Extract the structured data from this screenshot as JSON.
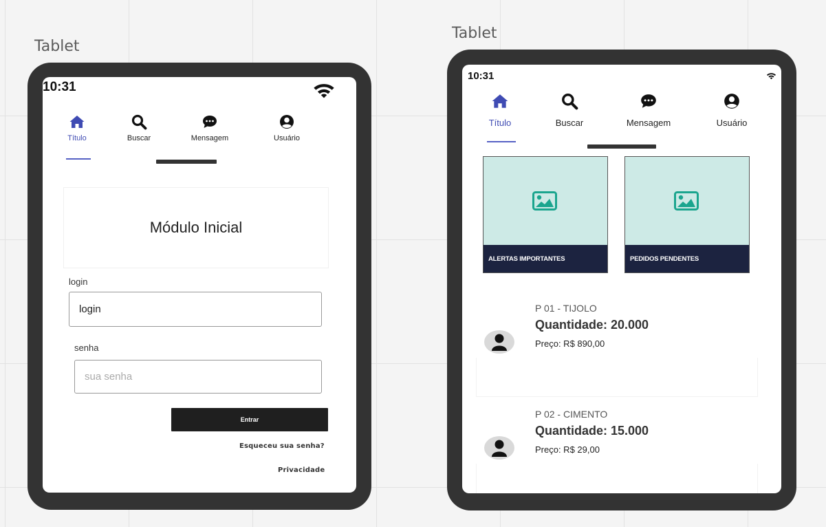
{
  "frames": [
    {
      "label": "Tablet",
      "status_bar": {
        "time": "10:31"
      },
      "nav": [
        {
          "label": "Título",
          "icon": "home-icon",
          "active": true
        },
        {
          "label": "Buscar",
          "icon": "search-icon",
          "active": false
        },
        {
          "label": "Mensagem",
          "icon": "chat-icon",
          "active": false
        },
        {
          "label": "Usuário",
          "icon": "user-circle-icon",
          "active": false
        }
      ],
      "title_card": "Módulo Inicial",
      "login": {
        "label": "login",
        "value": "login"
      },
      "password": {
        "label": "senha",
        "placeholder": "sua senha"
      },
      "enter_button": "Entrar",
      "forgot_link": "Esqueceu sua senha?",
      "privacy_link": "Privacidade"
    },
    {
      "label": "Tablet",
      "status_bar": {
        "time": "10:31"
      },
      "nav": [
        {
          "label": "Título",
          "icon": "home-icon",
          "active": true
        },
        {
          "label": "Buscar",
          "icon": "search-icon",
          "active": false
        },
        {
          "label": "Mensagem",
          "icon": "chat-icon",
          "active": false
        },
        {
          "label": "Usuário",
          "icon": "user-circle-icon",
          "active": false
        }
      ],
      "tiles": [
        {
          "label": "ALERTAS IMPORTANTES",
          "icon": "image-icon"
        },
        {
          "label": "PEDIDOS PENDENTES",
          "icon": "image-icon"
        }
      ],
      "products": [
        {
          "code": "P 01 - TIJOLO",
          "quantity": "Quantidade: 20.000",
          "price": "Preço: R$ 890,00"
        },
        {
          "code": "P 02 - CIMENTO",
          "quantity": "Quantidade: 15.000",
          "price": "Preço: R$  29,00"
        }
      ]
    }
  ],
  "colors": {
    "accent": "#3f4bb3",
    "tile_bg": "#cdeae6",
    "tile_footer": "#1c2340",
    "image_icon": "#1aa58e",
    "button": "#1f1f1f"
  }
}
